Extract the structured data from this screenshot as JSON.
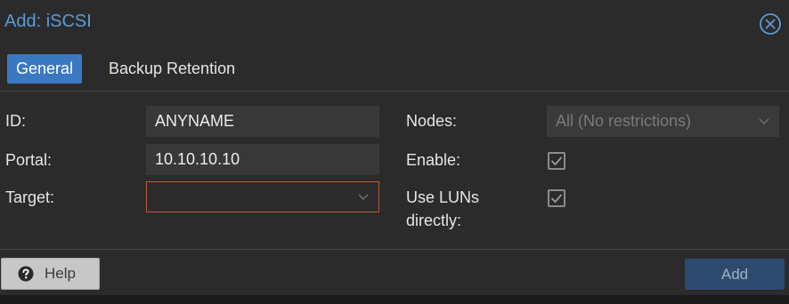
{
  "dialog": {
    "title": "Add: iSCSI",
    "close_icon": "close-circle-icon"
  },
  "tabs": [
    {
      "label": "General",
      "active": true
    },
    {
      "label": "Backup Retention",
      "active": false
    }
  ],
  "form": {
    "id_label": "ID:",
    "id_value": "ANYNAME",
    "portal_label": "Portal:",
    "portal_value": "10.10.10.10",
    "target_label": "Target:",
    "target_value": "",
    "nodes_label": "Nodes:",
    "nodes_value": "All (No restrictions)",
    "enable_label": "Enable:",
    "enable_checked": true,
    "use_luns_label_line1": "Use LUNs",
    "use_luns_label_line2": "directly:",
    "use_luns_checked": true
  },
  "footer": {
    "help_label": "Help",
    "help_icon": "question-circle-icon",
    "add_label": "Add"
  },
  "colors": {
    "accent": "#3a78c2",
    "title": "#5b9bd5",
    "invalid_border": "#c0553a"
  }
}
